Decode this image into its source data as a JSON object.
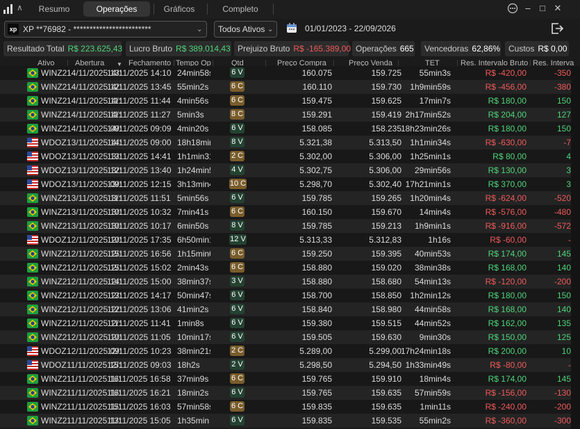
{
  "tabs": [
    "Resumo",
    "Operações",
    "Gráficos",
    "Completo"
  ],
  "active_tab": "Operações",
  "window_controls": [
    "…",
    "–",
    "□",
    "✕"
  ],
  "account": {
    "broker_badge": "xp",
    "label": "XP  **76982 - ************************"
  },
  "asset_filter": "Todos Ativos",
  "date_range": "01/01/2023 - 22/09/2026",
  "summary": [
    {
      "label": "Resultado Total",
      "value": "R$ 223.625,43",
      "color": "green"
    },
    {
      "label": "Lucro Bruto",
      "value": "R$ 389.014,43",
      "color": "green"
    },
    {
      "label": "Prejuizo Bruto",
      "value": "R$ -165.389,00",
      "color": "red"
    },
    {
      "label": "Operações",
      "value": "665",
      "color": "white"
    },
    {
      "label": "Vencedoras",
      "value": "62,86%",
      "color": "white"
    },
    {
      "label": "Custos",
      "value": "R$ 0,00",
      "color": "white"
    }
  ],
  "columns": [
    "Ativo",
    "Abertura",
    "Fechamento",
    "Tempo Op",
    "Qtd",
    "Preço Compra",
    "Preço Venda",
    "TET",
    "Res. Intervalo Bruto",
    "Res. Interva"
  ],
  "rows": [
    {
      "flag": "br",
      "ativo": "WINZ2!",
      "abertura": "14/11/2025 13:",
      "fechamento": "14/11/2025 14:10",
      "tempo": "24min58s",
      "qtd": "6 V",
      "compra": "160.075",
      "venda": "159.725",
      "tet": "55min3s",
      "res": "R$ -420,00",
      "res2": "-350"
    },
    {
      "flag": "br",
      "ativo": "WINZ2!",
      "abertura": "14/11/2025 12:",
      "fechamento": "14/11/2025 13:45",
      "tempo": "55min2s",
      "qtd": "6 C",
      "compra": "160.110",
      "venda": "159.730",
      "tet": "1h9min59s",
      "res": "R$ -456,00",
      "res2": "-380"
    },
    {
      "flag": "br",
      "ativo": "WINZ2!",
      "abertura": "14/11/2025 11:",
      "fechamento": "14/11/2025 11:44",
      "tempo": "4min56s",
      "qtd": "6 C",
      "compra": "159.475",
      "venda": "159.625",
      "tet": "17min7s",
      "res": "R$ 180,00",
      "res2": "150"
    },
    {
      "flag": "br",
      "ativo": "WINZ2!",
      "abertura": "14/11/2025 11:",
      "fechamento": "14/11/2025 11:27",
      "tempo": "5min3s",
      "qtd": "8 C",
      "compra": "159.291",
      "venda": "159.419",
      "tet": "2h17min52s",
      "res": "R$ 204,00",
      "res2": "127"
    },
    {
      "flag": "br",
      "ativo": "WINZ2!",
      "abertura": "14/11/2025 09:",
      "fechamento": "14/11/2025 09:09",
      "tempo": "4min20s",
      "qtd": "6 V",
      "compra": "158.085",
      "venda": "158.235",
      "tet": "18h23min26s",
      "res": "R$ 180,00",
      "res2": "150"
    },
    {
      "flag": "us",
      "ativo": "WDOZ2",
      "abertura": "13/11/2025 14:",
      "fechamento": "14/11/2025 09:00",
      "tempo": "18h18min5",
      "qtd": "8 V",
      "compra": "5.321,38",
      "venda": "5.313,50",
      "tet": "1h1min34s",
      "res": "R$ -630,00",
      "res2": "-7"
    },
    {
      "flag": "us",
      "ativo": "WDOZ2",
      "abertura": "13/11/2025 13:",
      "fechamento": "13/11/2025 14:41",
      "tempo": "1h1min31s",
      "qtd": "2 C",
      "compra": "5.302,00",
      "venda": "5.306,00",
      "tet": "1h25min1s",
      "res": "R$ 80,00",
      "res2": "4"
    },
    {
      "flag": "us",
      "ativo": "WDOZ2",
      "abertura": "13/11/2025 12:",
      "fechamento": "13/11/2025 13:40",
      "tempo": "1h24min59",
      "qtd": "4 V",
      "compra": "5.302,75",
      "venda": "5.306,00",
      "tet": "29min56s",
      "res": "R$ 130,00",
      "res2": "3"
    },
    {
      "flag": "us",
      "ativo": "WDOZ2",
      "abertura": "13/11/2025 09:",
      "fechamento": "13/11/2025 12:15",
      "tempo": "3h13min4s",
      "qtd": "10 C",
      "compra": "5.298,70",
      "venda": "5.302,40",
      "tet": "17h21min1s",
      "res": "R$ 370,00",
      "res2": "3"
    },
    {
      "flag": "br",
      "ativo": "WINZ2!",
      "abertura": "13/11/2025 11:",
      "fechamento": "13/11/2025 11:51",
      "tempo": "5min56s",
      "qtd": "6 V",
      "compra": "159.785",
      "venda": "159.265",
      "tet": "1h20min4s",
      "res": "R$ -624,00",
      "res2": "-520"
    },
    {
      "flag": "br",
      "ativo": "WINZ2!",
      "abertura": "13/11/2025 10:",
      "fechamento": "13/11/2025 10:32",
      "tempo": "7min41s",
      "qtd": "6 C",
      "compra": "160.150",
      "venda": "159.670",
      "tet": "14min4s",
      "res": "R$ -576,00",
      "res2": "-480"
    },
    {
      "flag": "br",
      "ativo": "WINZ2!",
      "abertura": "13/11/2025 10:",
      "fechamento": "13/11/2025 10:17",
      "tempo": "6min50s",
      "qtd": "8 V",
      "compra": "159.785",
      "venda": "159.213",
      "tet": "1h9min1s",
      "res": "R$ -916,00",
      "res2": "-572"
    },
    {
      "flag": "us",
      "ativo": "WDOZ2",
      "abertura": "12/11/2025 10:",
      "fechamento": "12/11/2025 17:35",
      "tempo": "6h50min16",
      "qtd": "12 V",
      "compra": "5.313,33",
      "venda": "5.312,83",
      "tet": "1h16s",
      "res": "R$ -60,00",
      "res2": "-"
    },
    {
      "flag": "br",
      "ativo": "WINZ2!",
      "abertura": "12/11/2025 15:",
      "fechamento": "12/11/2025 16:56",
      "tempo": "1h15min6s",
      "qtd": "6 C",
      "compra": "159.250",
      "venda": "159.395",
      "tet": "40min53s",
      "res": "R$ 174,00",
      "res2": "145"
    },
    {
      "flag": "br",
      "ativo": "WINZ2!",
      "abertura": "12/11/2025 15:",
      "fechamento": "12/11/2025 15:02",
      "tempo": "2min43s",
      "qtd": "6 C",
      "compra": "158.880",
      "venda": "159.020",
      "tet": "38min38s",
      "res": "R$ 168,00",
      "res2": "140"
    },
    {
      "flag": "br",
      "ativo": "WINZ2!",
      "abertura": "12/11/2025 14:",
      "fechamento": "12/11/2025 15:00",
      "tempo": "38min37s",
      "qtd": "3 V",
      "compra": "158.880",
      "venda": "158.680",
      "tet": "54min13s",
      "res": "R$ -120,00",
      "res2": "-200"
    },
    {
      "flag": "br",
      "ativo": "WINZ2!",
      "abertura": "12/11/2025 13:",
      "fechamento": "12/11/2025 14:17",
      "tempo": "50min47s",
      "qtd": "6 V",
      "compra": "158.700",
      "venda": "158.850",
      "tet": "1h2min12s",
      "res": "R$ 180,00",
      "res2": "150"
    },
    {
      "flag": "br",
      "ativo": "WINZ2!",
      "abertura": "12/11/2025 12:",
      "fechamento": "12/11/2025 13:06",
      "tempo": "41min2s",
      "qtd": "6 V",
      "compra": "158.840",
      "venda": "158.980",
      "tet": "44min58s",
      "res": "R$ 168,00",
      "res2": "140"
    },
    {
      "flag": "br",
      "ativo": "WINZ2!",
      "abertura": "12/11/2025 11:",
      "fechamento": "12/11/2025 11:41",
      "tempo": "1min8s",
      "qtd": "6 V",
      "compra": "159.380",
      "venda": "159.515",
      "tet": "44min52s",
      "res": "R$ 162,00",
      "res2": "135"
    },
    {
      "flag": "br",
      "ativo": "WINZ2!",
      "abertura": "12/11/2025 10:",
      "fechamento": "12/11/2025 11:05",
      "tempo": "10min17s",
      "qtd": "6 V",
      "compra": "159.505",
      "venda": "159.630",
      "tet": "9min30s",
      "res": "R$ 150,00",
      "res2": "125"
    },
    {
      "flag": "us",
      "ativo": "WDOZ2",
      "abertura": "12/11/2025 09:",
      "fechamento": "12/11/2025 10:23",
      "tempo": "38min21s",
      "qtd": "2 C",
      "compra": "5.289,00",
      "venda": "5.299,00",
      "tet": "17h24min18s",
      "res": "R$ 200,00",
      "res2": "10"
    },
    {
      "flag": "us",
      "ativo": "WDOZ2",
      "abertura": "11/11/2025 15:",
      "fechamento": "12/11/2025 09:03",
      "tempo": "18h2s",
      "qtd": "2 V",
      "compra": "5.298,50",
      "venda": "5.294,50",
      "tet": "1h33min49s",
      "res": "R$ -80,00",
      "res2": "-"
    },
    {
      "flag": "br",
      "ativo": "WINZ2!",
      "abertura": "11/11/2025 16:",
      "fechamento": "11/11/2025 16:58",
      "tempo": "37min9s",
      "qtd": "6 C",
      "compra": "159.765",
      "venda": "159.910",
      "tet": "18min4s",
      "res": "R$ 174,00",
      "res2": "145"
    },
    {
      "flag": "br",
      "ativo": "WINZ2!",
      "abertura": "11/11/2025 16:",
      "fechamento": "11/11/2025 16:21",
      "tempo": "18min2s",
      "qtd": "6 V",
      "compra": "159.765",
      "venda": "159.635",
      "tet": "57min59s",
      "res": "R$ -156,00",
      "res2": "-130"
    },
    {
      "flag": "br",
      "ativo": "WINZ2!",
      "abertura": "11/11/2025 15:",
      "fechamento": "11/11/2025 16:03",
      "tempo": "57min58s",
      "qtd": "6 C",
      "compra": "159.835",
      "venda": "159.635",
      "tet": "1min11s",
      "res": "R$ -240,00",
      "res2": "-200"
    },
    {
      "flag": "br",
      "ativo": "WINZ2!",
      "abertura": "11/11/2025 13:",
      "fechamento": "11/11/2025 15:05",
      "tempo": "1h35min",
      "qtd": "6 V",
      "compra": "159.835",
      "venda": "159.535",
      "tet": "55min2s",
      "res": "R$ -360,00",
      "res2": "-300"
    }
  ]
}
